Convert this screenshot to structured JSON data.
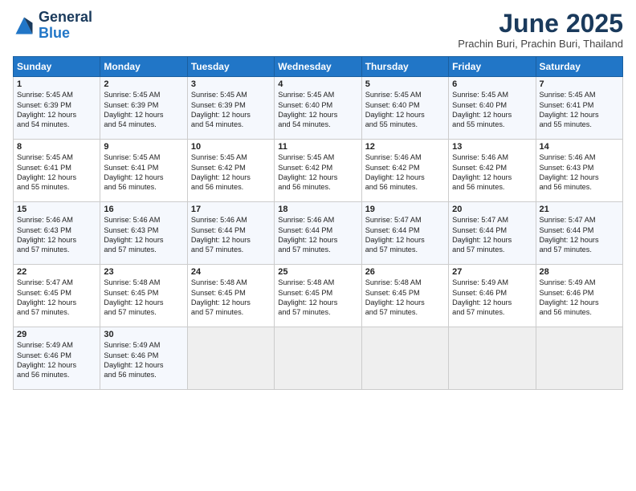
{
  "header": {
    "logo_general": "General",
    "logo_blue": "Blue",
    "title": "June 2025",
    "subtitle": "Prachin Buri, Prachin Buri, Thailand"
  },
  "weekdays": [
    "Sunday",
    "Monday",
    "Tuesday",
    "Wednesday",
    "Thursday",
    "Friday",
    "Saturday"
  ],
  "weeks": [
    [
      {
        "day": "1",
        "lines": [
          "Sunrise: 5:45 AM",
          "Sunset: 6:39 PM",
          "Daylight: 12 hours",
          "and 54 minutes."
        ]
      },
      {
        "day": "2",
        "lines": [
          "Sunrise: 5:45 AM",
          "Sunset: 6:39 PM",
          "Daylight: 12 hours",
          "and 54 minutes."
        ]
      },
      {
        "day": "3",
        "lines": [
          "Sunrise: 5:45 AM",
          "Sunset: 6:39 PM",
          "Daylight: 12 hours",
          "and 54 minutes."
        ]
      },
      {
        "day": "4",
        "lines": [
          "Sunrise: 5:45 AM",
          "Sunset: 6:40 PM",
          "Daylight: 12 hours",
          "and 54 minutes."
        ]
      },
      {
        "day": "5",
        "lines": [
          "Sunrise: 5:45 AM",
          "Sunset: 6:40 PM",
          "Daylight: 12 hours",
          "and 55 minutes."
        ]
      },
      {
        "day": "6",
        "lines": [
          "Sunrise: 5:45 AM",
          "Sunset: 6:40 PM",
          "Daylight: 12 hours",
          "and 55 minutes."
        ]
      },
      {
        "day": "7",
        "lines": [
          "Sunrise: 5:45 AM",
          "Sunset: 6:41 PM",
          "Daylight: 12 hours",
          "and 55 minutes."
        ]
      }
    ],
    [
      {
        "day": "8",
        "lines": [
          "Sunrise: 5:45 AM",
          "Sunset: 6:41 PM",
          "Daylight: 12 hours",
          "and 55 minutes."
        ]
      },
      {
        "day": "9",
        "lines": [
          "Sunrise: 5:45 AM",
          "Sunset: 6:41 PM",
          "Daylight: 12 hours",
          "and 56 minutes."
        ]
      },
      {
        "day": "10",
        "lines": [
          "Sunrise: 5:45 AM",
          "Sunset: 6:42 PM",
          "Daylight: 12 hours",
          "and 56 minutes."
        ]
      },
      {
        "day": "11",
        "lines": [
          "Sunrise: 5:45 AM",
          "Sunset: 6:42 PM",
          "Daylight: 12 hours",
          "and 56 minutes."
        ]
      },
      {
        "day": "12",
        "lines": [
          "Sunrise: 5:46 AM",
          "Sunset: 6:42 PM",
          "Daylight: 12 hours",
          "and 56 minutes."
        ]
      },
      {
        "day": "13",
        "lines": [
          "Sunrise: 5:46 AM",
          "Sunset: 6:42 PM",
          "Daylight: 12 hours",
          "and 56 minutes."
        ]
      },
      {
        "day": "14",
        "lines": [
          "Sunrise: 5:46 AM",
          "Sunset: 6:43 PM",
          "Daylight: 12 hours",
          "and 56 minutes."
        ]
      }
    ],
    [
      {
        "day": "15",
        "lines": [
          "Sunrise: 5:46 AM",
          "Sunset: 6:43 PM",
          "Daylight: 12 hours",
          "and 57 minutes."
        ]
      },
      {
        "day": "16",
        "lines": [
          "Sunrise: 5:46 AM",
          "Sunset: 6:43 PM",
          "Daylight: 12 hours",
          "and 57 minutes."
        ]
      },
      {
        "day": "17",
        "lines": [
          "Sunrise: 5:46 AM",
          "Sunset: 6:44 PM",
          "Daylight: 12 hours",
          "and 57 minutes."
        ]
      },
      {
        "day": "18",
        "lines": [
          "Sunrise: 5:46 AM",
          "Sunset: 6:44 PM",
          "Daylight: 12 hours",
          "and 57 minutes."
        ]
      },
      {
        "day": "19",
        "lines": [
          "Sunrise: 5:47 AM",
          "Sunset: 6:44 PM",
          "Daylight: 12 hours",
          "and 57 minutes."
        ]
      },
      {
        "day": "20",
        "lines": [
          "Sunrise: 5:47 AM",
          "Sunset: 6:44 PM",
          "Daylight: 12 hours",
          "and 57 minutes."
        ]
      },
      {
        "day": "21",
        "lines": [
          "Sunrise: 5:47 AM",
          "Sunset: 6:44 PM",
          "Daylight: 12 hours",
          "and 57 minutes."
        ]
      }
    ],
    [
      {
        "day": "22",
        "lines": [
          "Sunrise: 5:47 AM",
          "Sunset: 6:45 PM",
          "Daylight: 12 hours",
          "and 57 minutes."
        ]
      },
      {
        "day": "23",
        "lines": [
          "Sunrise: 5:48 AM",
          "Sunset: 6:45 PM",
          "Daylight: 12 hours",
          "and 57 minutes."
        ]
      },
      {
        "day": "24",
        "lines": [
          "Sunrise: 5:48 AM",
          "Sunset: 6:45 PM",
          "Daylight: 12 hours",
          "and 57 minutes."
        ]
      },
      {
        "day": "25",
        "lines": [
          "Sunrise: 5:48 AM",
          "Sunset: 6:45 PM",
          "Daylight: 12 hours",
          "and 57 minutes."
        ]
      },
      {
        "day": "26",
        "lines": [
          "Sunrise: 5:48 AM",
          "Sunset: 6:45 PM",
          "Daylight: 12 hours",
          "and 57 minutes."
        ]
      },
      {
        "day": "27",
        "lines": [
          "Sunrise: 5:49 AM",
          "Sunset: 6:46 PM",
          "Daylight: 12 hours",
          "and 57 minutes."
        ]
      },
      {
        "day": "28",
        "lines": [
          "Sunrise: 5:49 AM",
          "Sunset: 6:46 PM",
          "Daylight: 12 hours",
          "and 56 minutes."
        ]
      }
    ],
    [
      {
        "day": "29",
        "lines": [
          "Sunrise: 5:49 AM",
          "Sunset: 6:46 PM",
          "Daylight: 12 hours",
          "and 56 minutes."
        ]
      },
      {
        "day": "30",
        "lines": [
          "Sunrise: 5:49 AM",
          "Sunset: 6:46 PM",
          "Daylight: 12 hours",
          "and 56 minutes."
        ]
      },
      {
        "day": "",
        "lines": []
      },
      {
        "day": "",
        "lines": []
      },
      {
        "day": "",
        "lines": []
      },
      {
        "day": "",
        "lines": []
      },
      {
        "day": "",
        "lines": []
      }
    ]
  ]
}
